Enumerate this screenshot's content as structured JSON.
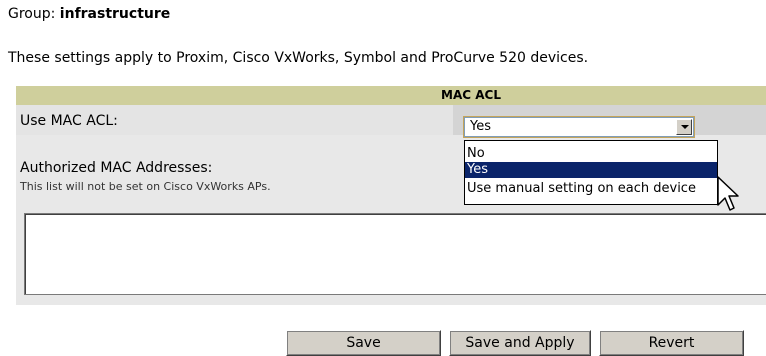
{
  "group": {
    "prefix": "Group: ",
    "name": "infrastructure"
  },
  "description": "These settings apply to Proxim, Cisco VxWorks, Symbol and ProCurve 520 devices.",
  "panel": {
    "title": "MAC ACL",
    "use_mac_acl_label": "Use MAC ACL:",
    "authorized_label": "Authorized MAC Addresses:",
    "authorized_note": "This list will not be set on Cisco VxWorks APs.",
    "authorized_value": ""
  },
  "select": {
    "value": "Yes",
    "options": [
      "No",
      "Yes",
      "Use manual setting on each device"
    ],
    "highlighted": "Yes"
  },
  "buttons": {
    "save": "Save",
    "save_apply": "Save and Apply",
    "revert": "Revert"
  },
  "colors": {
    "header_bg": "#cfcf9c",
    "highlight": "#0a246a",
    "panel_bg": "#e8e8e8"
  },
  "icons": {
    "cursor": "arrow-cursor-icon",
    "dropdown": "chevron-down-icon"
  }
}
